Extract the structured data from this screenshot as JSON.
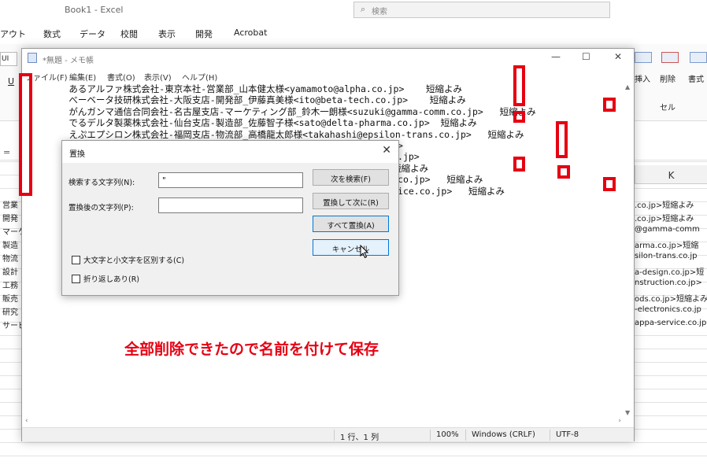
{
  "excel": {
    "title": "Book1  -  Excel",
    "search_placeholder": "検索",
    "tabs": [
      "アウト",
      "数式",
      "データ",
      "校閲",
      "表示",
      "開発",
      "Acrobat"
    ],
    "font_box": "UI",
    "underline": "U",
    "insert_label": "挿入",
    "delete_label": "削除",
    "format_label": "書式",
    "cells_label": "セル",
    "formula_eq": "=",
    "col_k": "K",
    "left_col": [
      "営業",
      "開発",
      "マーケ",
      "製造",
      "物流",
      "設計",
      "工務",
      "販売",
      "研究",
      "サービ"
    ],
    "right_col": [
      ".co.jp>短縮よみ",
      ".co.jp>短縮よみ",
      "@gamma-comm",
      "arma.co.jp>短縮",
      "silon-trans.co.jp",
      "a-design.co.jp>短",
      "nstruction.co.jp>",
      "ods.co.jp>短縮よみ",
      "-electronics.co.jp",
      "appa-service.co.jp"
    ]
  },
  "notepad": {
    "title": "*無題 - メモ帳",
    "menu": [
      "ファイル(F)",
      "編集(E)",
      "書式(O)",
      "表示(V)",
      "ヘルプ(H)"
    ],
    "lines": [
      "\tあるアルファ株式会社-東京本社-営業部_山本健太様<yamamoto@alpha.co.jp>    短縮よみ",
      "\tべーベータ技研株式会社-大阪支店-開発部_伊藤真美様<ito@beta-tech.co.jp>    短縮よみ",
      "\tがんガンマ通信合同会社-名古屋支店-マーケティング部_鈴木一朗様<suzuki@gamma-comm.co.jp>   短縮よみ",
      "\tでるデルタ製薬株式会社-仙台支店-製造部_佐藤智子様<sato@delta-pharma.co.jp>  短縮よみ",
      "\tえぷエプシロン株式会社-福岡支店-物流部_高橋龍太郎様<takahashi@epsilon-trans.co.jp>   短縮よみ",
      "\tぜー                                            -design.co.jp>",
      "\tいー                                            nstruction.co.jp>",
      "\tしー                                            ods.co.jp>  短縮よみ",
      "\tいお                                            -electronics.co.jp>   短縮よみ",
      "\tかっ                                            hi@kappa-service.co.jp>   短縮よみ"
    ],
    "status": {
      "position": "1 行、1 列",
      "zoom": "100%",
      "line_ending": "Windows (CRLF)",
      "encoding": "UTF-8"
    }
  },
  "dialog": {
    "title": "置換",
    "find_label": "検索する文字列(N):",
    "find_value": "\"",
    "replace_label": "置換後の文字列(P):",
    "replace_value": "",
    "find_next": "次を検索(F)",
    "replace_next": "置換して次に(R)",
    "replace_all": "すべて置換(A)",
    "cancel": "キャンセル",
    "match_case": "大文字と小文字を区別する(C)",
    "wrap": "折り返しあり(R)"
  },
  "annotation": "全部削除できたので名前を付けて保存",
  "colors": {
    "annotation_red": "#e60012",
    "focus_blue": "#0078d7"
  }
}
